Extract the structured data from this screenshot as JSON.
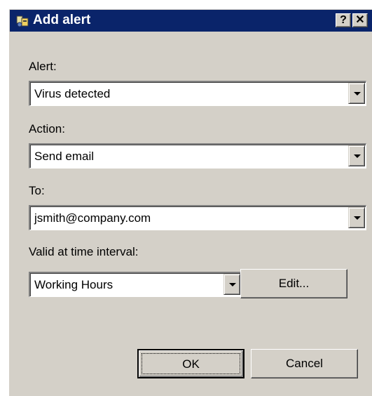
{
  "window": {
    "title": "Add alert",
    "help_label": "?",
    "close_label": "✕",
    "icon": "alert-app-icon"
  },
  "form": {
    "alert_label": "Alert:",
    "alert_value": "Virus detected",
    "action_label": "Action:",
    "action_value": "Send email",
    "to_label": "To:",
    "to_value": "jsmith@company.com",
    "interval_label": "Valid at time interval:",
    "interval_value": "Working Hours",
    "edit_label": "Edit..."
  },
  "buttons": {
    "ok_label": "OK",
    "cancel_label": "Cancel"
  },
  "colors": {
    "titlebar": "#0a246a",
    "face": "#d4d0c8"
  }
}
